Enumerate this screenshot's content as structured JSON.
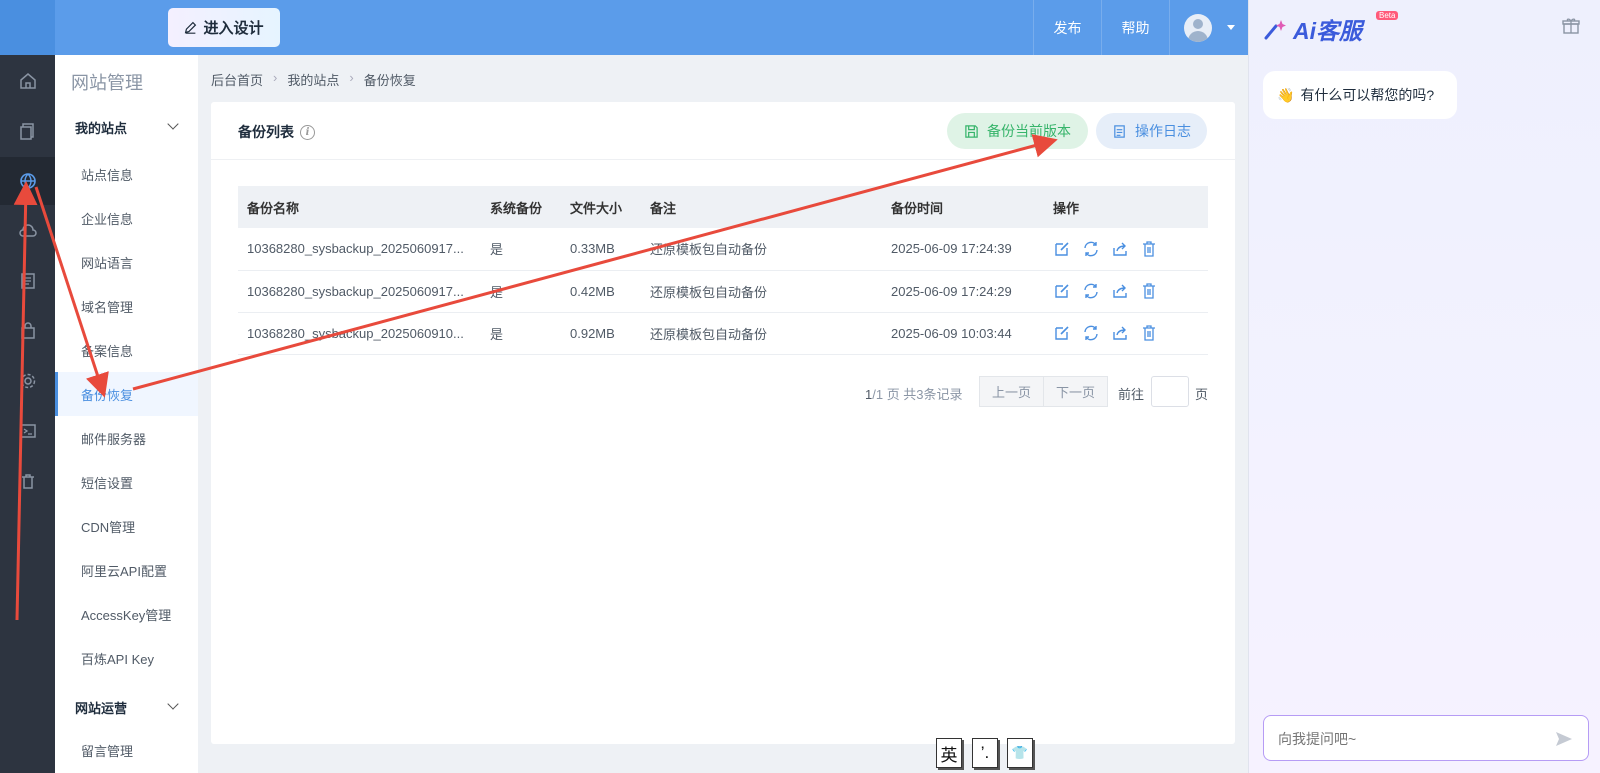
{
  "topbar": {
    "design_button": "进入设计",
    "publish": "发布",
    "help": "帮助"
  },
  "subnav": {
    "title": "网站管理",
    "group_my_sites": "我的站点",
    "items": [
      "站点信息",
      "企业信息",
      "网站语言",
      "域名管理",
      "备案信息",
      "备份恢复",
      "邮件服务器",
      "短信设置",
      "CDN管理",
      "阿里云API配置",
      "AccessKey管理",
      "百炼API Key"
    ],
    "group_operations": "网站运营",
    "items2": [
      "留言管理"
    ]
  },
  "breadcrumb": [
    "后台首页",
    "我的站点",
    "备份恢复"
  ],
  "card": {
    "title": "备份列表",
    "backup_button": "备份当前版本",
    "log_button": "操作日志"
  },
  "table": {
    "headers": [
      "备份名称",
      "系统备份",
      "文件大小",
      "备注",
      "备份时间",
      "操作"
    ],
    "rows": [
      {
        "name": "10368280_sysbackup_2025060917...",
        "system": "是",
        "size": "0.33MB",
        "note": "还原模板包自动备份",
        "time": "2025-06-09 17:24:39"
      },
      {
        "name": "10368280_sysbackup_2025060917...",
        "system": "是",
        "size": "0.42MB",
        "note": "还原模板包自动备份",
        "time": "2025-06-09 17:24:29"
      },
      {
        "name": "10368280_sysbackup_2025060910...",
        "system": "是",
        "size": "0.92MB",
        "note": "还原模板包自动备份",
        "time": "2025-06-09 10:03:44"
      }
    ]
  },
  "pager": {
    "current": "1",
    "total_text": "/1 页 共3条记录",
    "prev": "上一页",
    "next": "下一页",
    "goto": "前往",
    "suffix": "页"
  },
  "ime": [
    "英",
    "’.",
    "👕"
  ],
  "ai": {
    "logo_text": "Ai客服",
    "beta": "Beta",
    "greeting_emoji": "👋",
    "greeting": "有什么可以帮您的吗?",
    "input_placeholder": "向我提问吧~"
  },
  "colors": {
    "topbar": "#5b9cea",
    "rail": "#2d3440",
    "accent": "#4a8fe0",
    "backup_green": "#36b46a",
    "annotation_red": "#e84a3c"
  }
}
